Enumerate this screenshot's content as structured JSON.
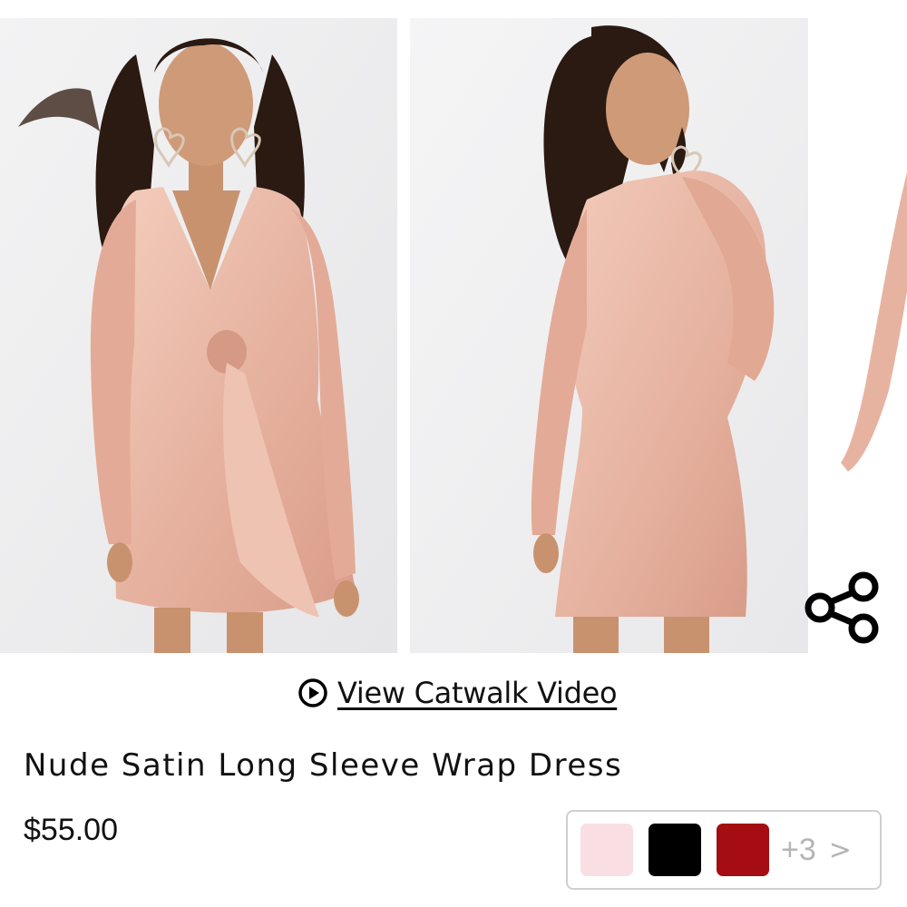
{
  "gallery": {
    "images": [
      {
        "name": "product-photo-front"
      },
      {
        "name": "product-photo-back"
      },
      {
        "name": "product-photo-partial"
      }
    ]
  },
  "share": {
    "icon": "share-icon"
  },
  "catwalk": {
    "icon": "play-circle-icon",
    "label": "View Catwalk Video"
  },
  "product": {
    "title": "Nude Satin Long Sleeve Wrap Dress",
    "price": "$55.00"
  },
  "swatches": {
    "colors": [
      "#f9dfe3",
      "#000000",
      "#a50d12"
    ],
    "more_label": "+3",
    "chevron": ">"
  },
  "colors": {
    "dress": "#e9b9a8",
    "hair": "#2a1a12",
    "skin": "#c9926f",
    "text": "#111111",
    "muted": "#b5b5b5"
  }
}
